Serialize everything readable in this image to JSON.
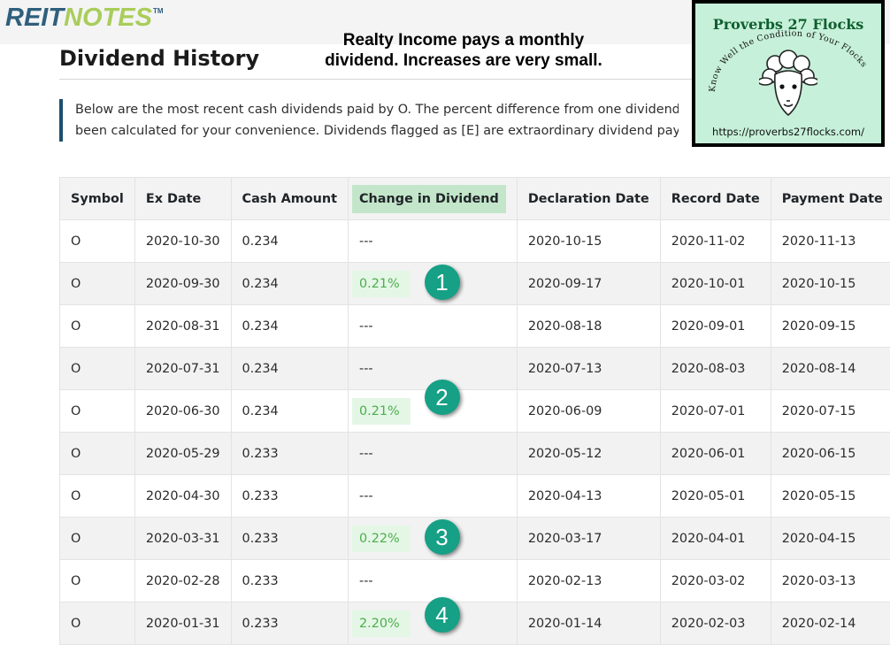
{
  "site": {
    "logo_part1": "REIT",
    "logo_part2": "NOTES",
    "logo_tm": "TM"
  },
  "page": {
    "title": "Dividend History",
    "intro_line1": "Below are the most recent cash dividends paid by O. The percent difference from one dividend pay",
    "intro_line2": "been calculated for your convenience. Dividends flagged as [E] are extraordinary dividend payment"
  },
  "annotation": {
    "line1": "Realty Income pays a monthly",
    "line2": "dividend. Increases are very small."
  },
  "badge": {
    "title": "Proverbs 27 Flocks",
    "arc_text": "Know Well the Condition of Your Flocks",
    "url": "https://proverbs27flocks.com/"
  },
  "colors": {
    "highlight_header": "#c3e6cb",
    "increase_text": "#4cae4c",
    "increase_bg": "#e4f7e6",
    "callout": "#16a085",
    "logo_blue": "#2f5f7e",
    "logo_green": "#a9cd5a"
  },
  "table": {
    "headers": [
      "Symbol",
      "Ex Date",
      "Cash Amount",
      "Change in Dividend",
      "Declaration Date",
      "Record Date",
      "Payment Date"
    ],
    "rows": [
      {
        "symbol": "O",
        "ex_date": "2020-10-30",
        "amount": "0.234",
        "change": "---",
        "declaration": "2020-10-15",
        "record": "2020-11-02",
        "payment": "2020-11-13"
      },
      {
        "symbol": "O",
        "ex_date": "2020-09-30",
        "amount": "0.234",
        "change": "0.21%",
        "declaration": "2020-09-17",
        "record": "2020-10-01",
        "payment": "2020-10-15"
      },
      {
        "symbol": "O",
        "ex_date": "2020-08-31",
        "amount": "0.234",
        "change": "---",
        "declaration": "2020-08-18",
        "record": "2020-09-01",
        "payment": "2020-09-15"
      },
      {
        "symbol": "O",
        "ex_date": "2020-07-31",
        "amount": "0.234",
        "change": "---",
        "declaration": "2020-07-13",
        "record": "2020-08-03",
        "payment": "2020-08-14"
      },
      {
        "symbol": "O",
        "ex_date": "2020-06-30",
        "amount": "0.234",
        "change": "0.21%",
        "declaration": "2020-06-09",
        "record": "2020-07-01",
        "payment": "2020-07-15"
      },
      {
        "symbol": "O",
        "ex_date": "2020-05-29",
        "amount": "0.233",
        "change": "---",
        "declaration": "2020-05-12",
        "record": "2020-06-01",
        "payment": "2020-06-15"
      },
      {
        "symbol": "O",
        "ex_date": "2020-04-30",
        "amount": "0.233",
        "change": "---",
        "declaration": "2020-04-13",
        "record": "2020-05-01",
        "payment": "2020-05-15"
      },
      {
        "symbol": "O",
        "ex_date": "2020-03-31",
        "amount": "0.233",
        "change": "0.22%",
        "declaration": "2020-03-17",
        "record": "2020-04-01",
        "payment": "2020-04-15"
      },
      {
        "symbol": "O",
        "ex_date": "2020-02-28",
        "amount": "0.233",
        "change": "---",
        "declaration": "2020-02-13",
        "record": "2020-03-02",
        "payment": "2020-03-13"
      },
      {
        "symbol": "O",
        "ex_date": "2020-01-31",
        "amount": "0.233",
        "change": "2.20%",
        "declaration": "2020-01-14",
        "record": "2020-02-03",
        "payment": "2020-02-14"
      }
    ]
  },
  "callouts": [
    "1",
    "2",
    "3",
    "4"
  ]
}
